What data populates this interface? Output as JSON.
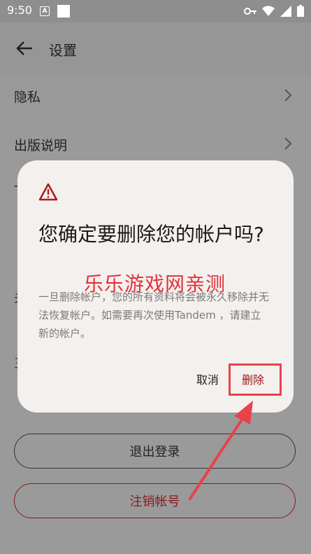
{
  "status_bar": {
    "time": "9:50",
    "a_badge": "A",
    "icons": [
      "key-icon",
      "wifi-icon",
      "signal-icon",
      "battery-icon"
    ]
  },
  "app_bar": {
    "back_icon": "arrow-left-icon",
    "title": "设置"
  },
  "settings": {
    "items": [
      {
        "label": "隐私",
        "icon": "chevron-right-icon"
      },
      {
        "label": "出版说明",
        "icon": "chevron-right-icon"
      }
    ],
    "partial_labels": [
      "一",
      "关",
      "三"
    ],
    "sign_out_label": "退出登录",
    "delete_account_label": "注销帐号"
  },
  "dialog": {
    "icon": "warning-icon",
    "title": "您确定要删除您的帐户吗?",
    "body": "一旦删除帐户，您的所有资料将会被永久移除并无法恢复帐户。如需要再次使用Tandem ，请建立新的帐户。",
    "watermark": "乐乐游戏网亲测",
    "cancel_label": "取消",
    "delete_label": "删除"
  },
  "colors": {
    "accent_red": "#e8424a",
    "danger": "#9a1a1a",
    "dialog_bg": "#f4f0ee"
  }
}
